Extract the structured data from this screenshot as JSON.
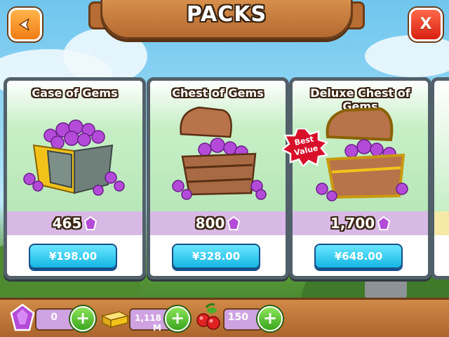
{
  "header": {
    "title": "PACKS",
    "back_icon": "back-arrow-icon",
    "close_label": "X"
  },
  "packs": [
    {
      "name": "Case of Gems",
      "gems": "465",
      "price": "¥198.00",
      "badge": ""
    },
    {
      "name": "Chest of Gems",
      "gems": "800",
      "price": "¥328.00",
      "badge": ""
    },
    {
      "name": "Deluxe Chest of Gems",
      "gems": "1,700",
      "price": "¥648.00",
      "badge": "Best Value"
    }
  ],
  "resources": {
    "gems": "0",
    "gold": "1,118 M",
    "food": "150"
  },
  "colors": {
    "gem": "#b44bd8",
    "buy_button": "#15b6e3",
    "plus_button": "#3aa61e",
    "badge": "#d8102a",
    "frame": "#52606a"
  }
}
